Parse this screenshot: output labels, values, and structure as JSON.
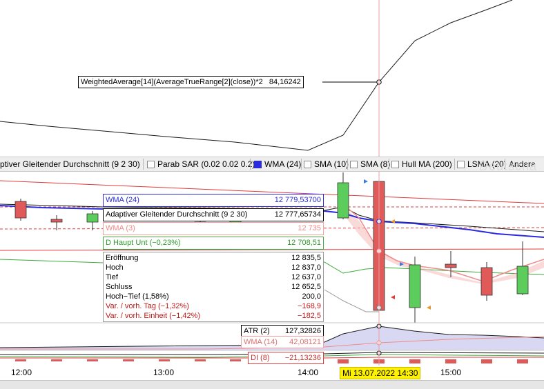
{
  "top_indicator": {
    "label": "WeightedAverage[14](AverageTrueRange[2](close))*2",
    "value": "84,16242"
  },
  "legend_strip": {
    "items": [
      {
        "label": "ptiver Gleitender Durchschnitt (9 2 30)",
        "checked": false,
        "color": "#000000"
      },
      {
        "label": "Parab SAR (0.02 0.02 0.2)",
        "checked": false,
        "color": "#000000"
      },
      {
        "label": "WMA (24)",
        "checked": true,
        "color": "#2a2adf"
      },
      {
        "label": "SMA (10)",
        "checked": false,
        "color": "#000000"
      },
      {
        "label": "SMA (8)",
        "checked": false,
        "color": "#000000"
      },
      {
        "label": "Hull MA (200)",
        "checked": false,
        "color": "#000000"
      },
      {
        "label": "LSMA (20)",
        "checked": false,
        "color": "#000000"
      },
      {
        "label": "Andere",
        "checked": null,
        "color": "#000000"
      }
    ],
    "watermark": "Deutscha"
  },
  "tooltips": {
    "wma24": {
      "label": "WMA (24)",
      "value": "12 779,53700"
    },
    "adaptive": {
      "label": "Adaptiver Gleitender Durchschnitt (9 2 30)",
      "value": "12 777,65734"
    },
    "wma3": {
      "label": "WMA (3)",
      "value": "12 735"
    },
    "d_haupt": {
      "label": "D Haupt Unt (−0,23%)",
      "value": "12 708,51"
    },
    "ohlc": [
      {
        "label": "Eröffnung",
        "value": "12 835,5",
        "tone": "normal"
      },
      {
        "label": "Hoch",
        "value": "12 837,0",
        "tone": "normal"
      },
      {
        "label": "Tief",
        "value": "12 637,0",
        "tone": "normal"
      },
      {
        "label": "Schluss",
        "value": "12 652,5",
        "tone": "normal"
      },
      {
        "label": "Hoch−Tief (1,58%)",
        "value": "200,0",
        "tone": "normal"
      },
      {
        "label": "Var. / vorh. Tag (−1,32%)",
        "value": "−168,9",
        "tone": "neg"
      },
      {
        "label": "Var. / vorh. Einheit (−1,42%)",
        "value": "−182,5",
        "tone": "neg"
      }
    ],
    "atr": {
      "label": "ATR (2)",
      "value": "127,32826"
    },
    "wma14": {
      "label": "WMA (14)",
      "value": "42,08121"
    },
    "di": {
      "label": "DI (8)",
      "value": "−21,13236"
    }
  },
  "time_axis": {
    "ticks": [
      "12:00",
      "13:00",
      "14:00",
      "15:00"
    ],
    "cursor_label": "Mi 13.07.2022 14:30"
  },
  "colors": {
    "up": "#5ccc5c",
    "down": "#e05a5a",
    "wma24": "#2a2adf",
    "red_line": "#e23a3a",
    "green_line": "#3caa3c",
    "cursor": "#e8a0a0"
  }
}
